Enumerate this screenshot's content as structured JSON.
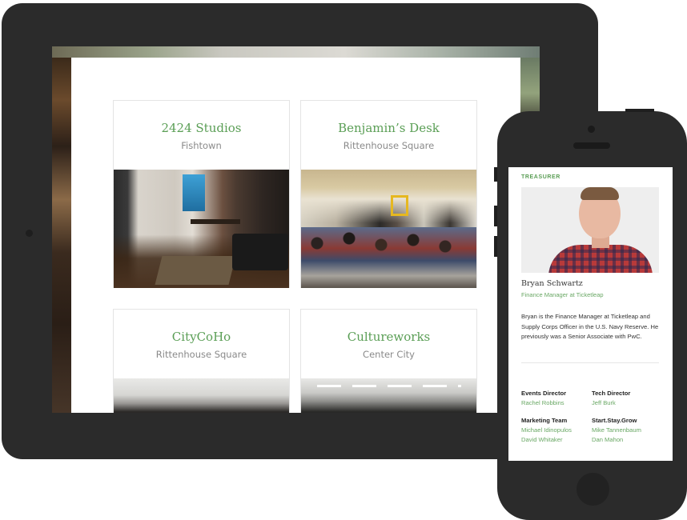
{
  "tablet": {
    "spaces": [
      {
        "name": "2424 Studios",
        "neighborhood": "Fishtown"
      },
      {
        "name": "Benjamin’s Desk",
        "neighborhood": "Rittenhouse Square"
      },
      {
        "name": "CityCoHo",
        "neighborhood": "Rittenhouse Square"
      },
      {
        "name": "Cultureworks",
        "neighborhood": "Center City"
      }
    ]
  },
  "phone": {
    "role": "TREASURER",
    "person": {
      "name": "Bryan Schwartz",
      "title": "Finance Manager at Ticketleap",
      "bio": "Bryan is the Finance Manager at Ticketleap and Supply Corps Officer in the U.S. Navy Reserve. He previously was a Senior Associate with PwC."
    },
    "teams": [
      {
        "title": "Events Director",
        "members": [
          "Rachel Robbins"
        ]
      },
      {
        "title": "Tech Director",
        "members": [
          "Jeff Burk"
        ]
      },
      {
        "title": "Marketing Team",
        "members": [
          "Michael Idinopulos",
          "David Whitaker"
        ]
      },
      {
        "title": "Start.Stay.Grow",
        "members": [
          "Mike Tannenbaum",
          "Dan Mahon"
        ]
      }
    ]
  },
  "colors": {
    "accent": "#5a9e55",
    "device": "#2b2b2b"
  }
}
